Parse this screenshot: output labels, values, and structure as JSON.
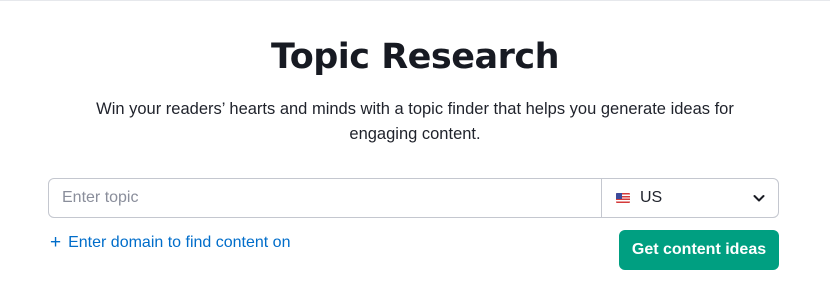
{
  "header": {
    "title": "Topic Research",
    "subtitle": "Win your readers’ hearts and minds with a topic finder that helps you generate ideas for engaging content."
  },
  "search": {
    "placeholder": "Enter topic",
    "value": ""
  },
  "country": {
    "selected": "US",
    "flag_icon": "us-flag-icon",
    "dropdown_icon": "chevron-down-icon"
  },
  "add_domain": {
    "icon": "plus-icon",
    "label": "Enter domain to find content on"
  },
  "cta": {
    "label": "Get content ideas"
  },
  "colors": {
    "link": "#006dca",
    "cta_background": "#009f81",
    "border": "#c4c7cf",
    "title_text": "#171a22"
  }
}
